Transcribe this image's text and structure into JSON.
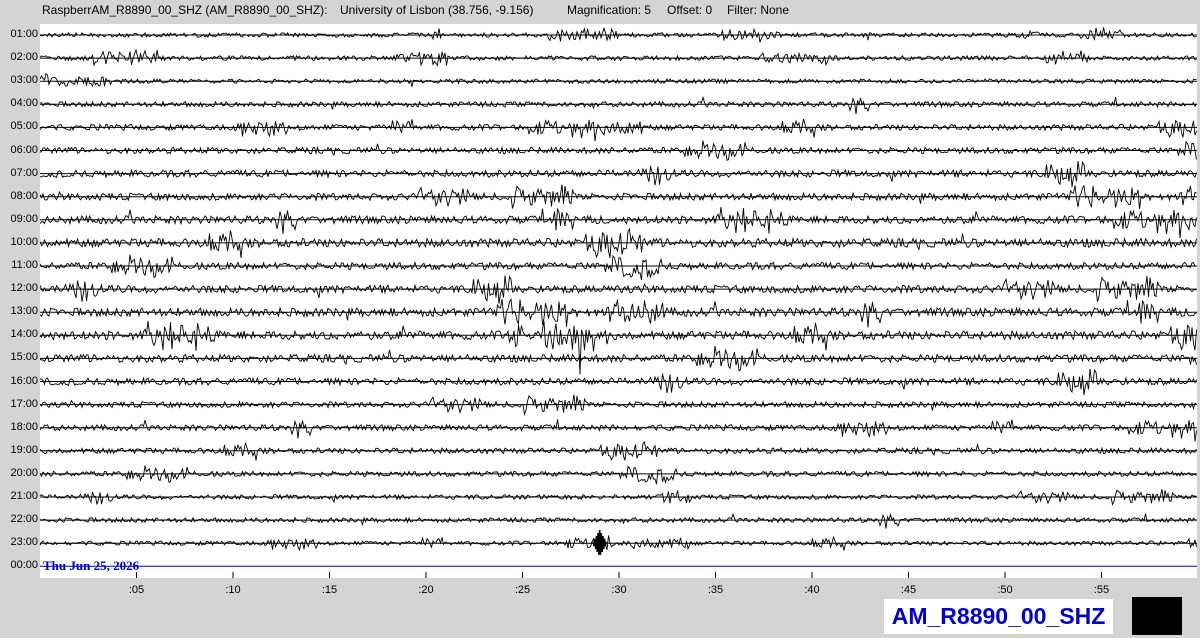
{
  "header": {
    "station": "RaspberrAM_R8890_00_SHZ (AM_R8890_00_SHZ):",
    "location": "University of Lisbon (38.756, -9.156)",
    "magnification": "Magnification: 5",
    "offset": "Offset: 0",
    "filter": "Filter: None"
  },
  "plot": {
    "hour_labels": [
      "01:00",
      "02:00",
      "03:00",
      "04:00",
      "05:00",
      "06:00",
      "07:00",
      "08:00",
      "09:00",
      "10:00",
      "11:00",
      "12:00",
      "13:00",
      "14:00",
      "15:00",
      "16:00",
      "17:00",
      "18:00",
      "19:00",
      "20:00",
      "21:00",
      "22:00",
      "23:00",
      "00:00"
    ],
    "date_label": "Thu Jun 25, 2026",
    "minute_ticks": [
      ":05",
      ":10",
      ":15",
      ":20",
      ":25",
      ":30",
      ":35",
      ":40",
      ":45",
      ":50",
      ":55"
    ],
    "trace_activity": [
      0.3,
      0.35,
      0.3,
      0.45,
      0.55,
      0.6,
      0.75,
      0.75,
      0.85,
      1.0,
      0.75,
      0.85,
      0.95,
      1.0,
      0.85,
      0.75,
      0.55,
      0.55,
      0.5,
      0.45,
      0.35,
      0.35,
      0.3
    ],
    "trace_color": "#000000",
    "current_line_color": "#0000cc"
  },
  "footer": {
    "station_badge": "AM_R8890_00_SHZ"
  }
}
